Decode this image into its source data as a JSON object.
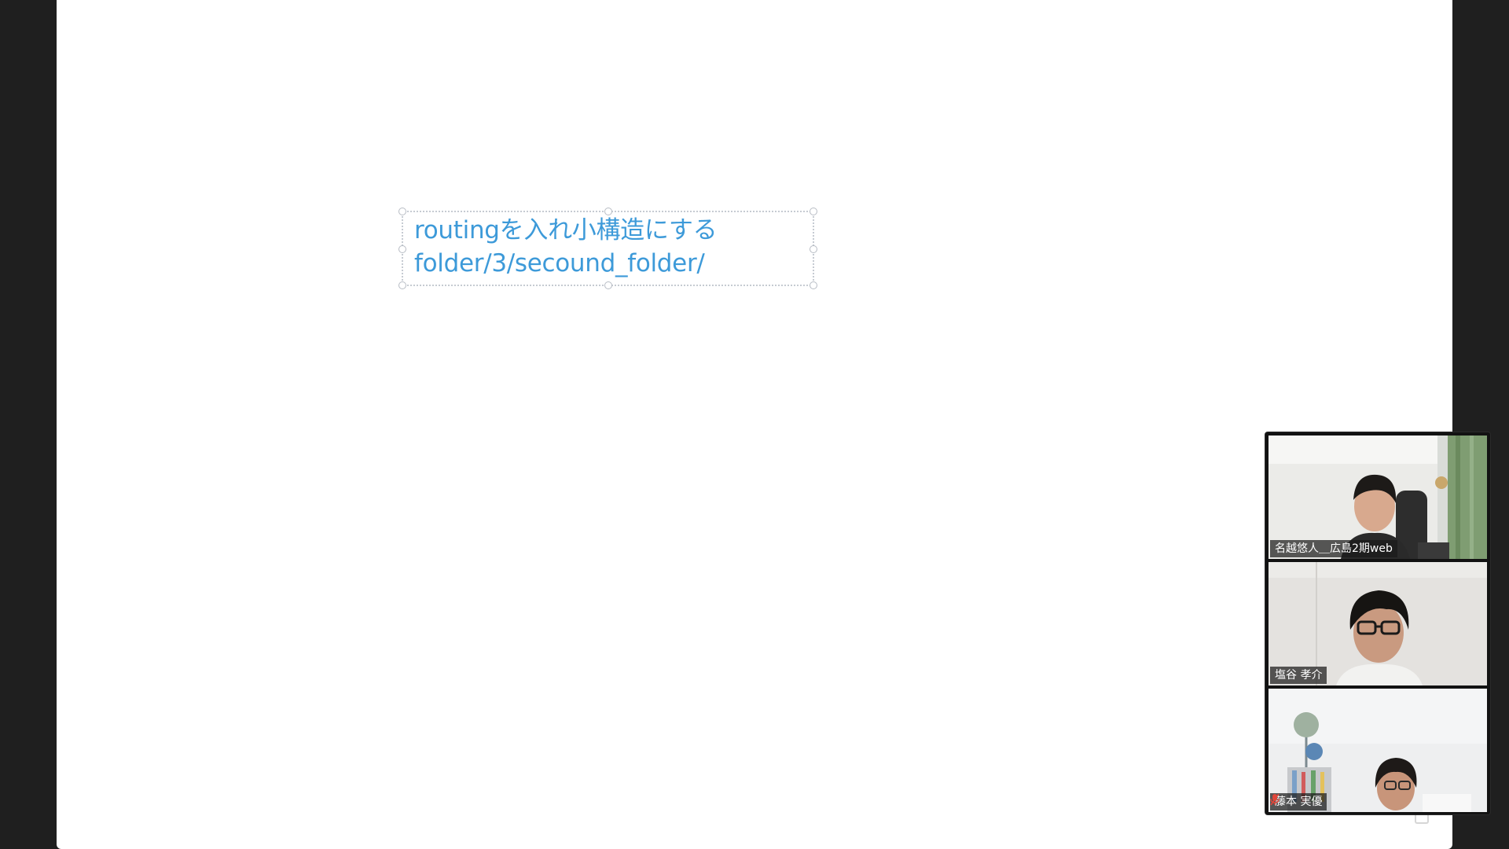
{
  "whiteboard": {
    "text_line_1": "routingを入れ小構造にする",
    "text_line_2": "folder/3/secound_folder/",
    "text_color": "#3d9ad9"
  },
  "participants": [
    {
      "name": "名越悠人＿広島2期web",
      "speaking": false,
      "muted": false
    },
    {
      "name": "塩谷 孝介",
      "speaking": true,
      "muted": false
    },
    {
      "name": "藤本 実優",
      "speaking": false,
      "muted": true
    }
  ],
  "colors": {
    "background": "#1f1f1f",
    "canvas": "#ffffff",
    "active_speaker_border": "#63c34b",
    "mute_icon": "#e0463a"
  }
}
